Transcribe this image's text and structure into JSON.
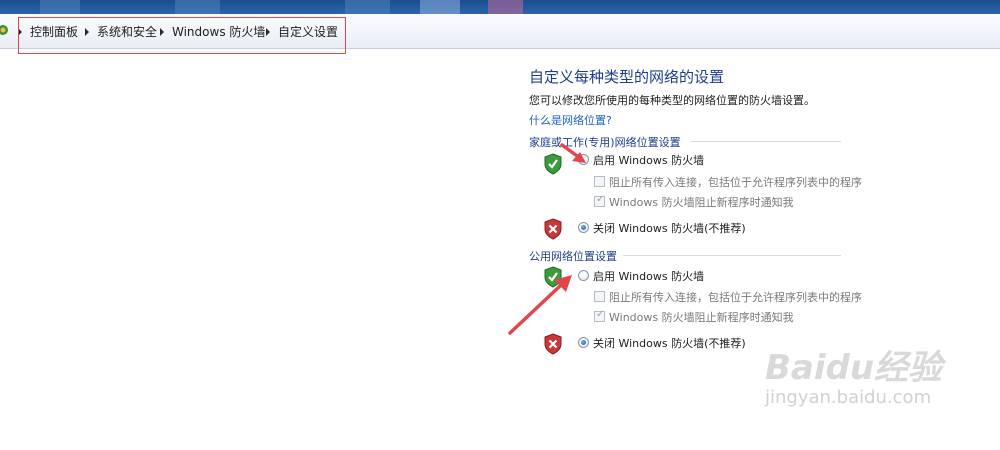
{
  "breadcrumb": {
    "items": [
      "控制面板",
      "系统和安全",
      "Windows 防火墙",
      "自定义设置"
    ]
  },
  "page": {
    "heading": "自定义每种类型的网络的设置",
    "description": "您可以修改您所使用的每种类型的网络位置的防火墙设置。",
    "link": "什么是网络位置?"
  },
  "sections": [
    {
      "label": "家庭或工作(专用)网络位置设置",
      "enable_label": "启用 Windows 防火墙",
      "block_all_label": "阻止所有传入连接，包括位于允许程序列表中的程序",
      "notify_label": "Windows 防火墙阻止新程序时通知我",
      "disable_label": "关闭 Windows 防火墙(不推荐)",
      "selected": "disable",
      "block_all_checked": false,
      "notify_checked": true
    },
    {
      "label": "公用网络位置设置",
      "enable_label": "启用 Windows 防火墙",
      "block_all_label": "阻止所有传入连接，包括位于允许程序列表中的程序",
      "notify_label": "Windows 防火墙阻止新程序时通知我",
      "disable_label": "关闭 Windows 防火墙(不推荐)",
      "selected": "disable",
      "block_all_checked": false,
      "notify_checked": true
    }
  ],
  "icons": {
    "shield_on": "shield-check-icon",
    "shield_off": "shield-x-icon"
  },
  "colors": {
    "heading": "#1e3d8c",
    "link": "#1c62c9",
    "annotation": "#e0474c"
  },
  "watermark": {
    "main": "Baidu经验",
    "sub": "jingyan.baidu.com"
  }
}
